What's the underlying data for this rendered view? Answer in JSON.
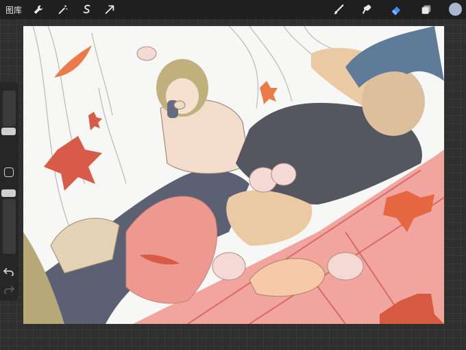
{
  "topbar": {
    "gallery_label": "图库",
    "left_tools": [
      "wrench-icon",
      "magic-wand-icon",
      "selection-icon",
      "transform-arrow-icon"
    ],
    "right_tools": [
      "brush-icon",
      "smudge-icon",
      "eraser-icon",
      "layers-icon",
      "color-swatch-icon"
    ],
    "active_tool": "eraser-icon"
  },
  "sidebar": {
    "controls": [
      "brush-size-slider",
      "modify-button",
      "opacity-slider",
      "undo-icon",
      "redo-icon"
    ]
  },
  "colors": {
    "accent_blue": "#3d8ef7",
    "current_color": "#a9b6cf",
    "app_background": "#2f2f2f",
    "toolbar": "#1f1f1f"
  }
}
